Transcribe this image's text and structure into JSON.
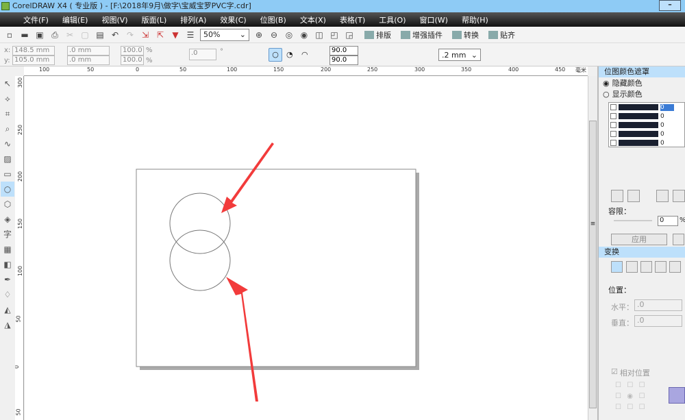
{
  "title": "CorelDRAW X4 ( 专业版 ) - [F:\\2018年9月\\做字\\宝威宝罗PVC字.cdr]",
  "menu": [
    "文件(F)",
    "编辑(E)",
    "视图(V)",
    "版面(L)",
    "排列(A)",
    "效果(C)",
    "位图(B)",
    "文本(X)",
    "表格(T)",
    "工具(O)",
    "窗口(W)",
    "帮助(H)"
  ],
  "toolbar": {
    "zoom": "50%",
    "plugins": [
      "排版",
      "增强插件",
      "转换",
      "贴齐"
    ]
  },
  "propbar": {
    "x": "148.5 mm",
    "y": "105.0 mm",
    "w": ".0 mm",
    "h": ".0 mm",
    "sx": "100.0",
    "sy": "100.0",
    "pct": "%",
    "rot": ".0",
    "deg": "°",
    "ang1": "90.0",
    "ang2": "90.0",
    "outline": ".2 mm",
    "x_label": "x:",
    "y_label": "y:"
  },
  "ruler": {
    "h": [
      "100",
      "50",
      "0",
      "50",
      "100",
      "150",
      "200",
      "250",
      "300",
      "350",
      "400",
      "450"
    ],
    "unit": "毫米",
    "v": [
      "300",
      "250",
      "200",
      "150",
      "100",
      "50",
      "0",
      "50"
    ]
  },
  "docker": {
    "title": "位图颜色遮罩",
    "hide": "隐藏颜色",
    "show": "显示颜色",
    "vals": [
      "0",
      "0",
      "0",
      "0",
      "0"
    ],
    "tolerance": "容限：",
    "tol_val": "0",
    "pct": "%",
    "apply": "应用",
    "transform": "变换",
    "position": "位置：",
    "horiz": "水平：",
    "vert": "垂直：",
    "hval": ".0",
    "vval": ".0",
    "relative": "相对位置"
  },
  "colors": {
    "arrow": "#f23b3b",
    "accent": "#bde0fb"
  }
}
